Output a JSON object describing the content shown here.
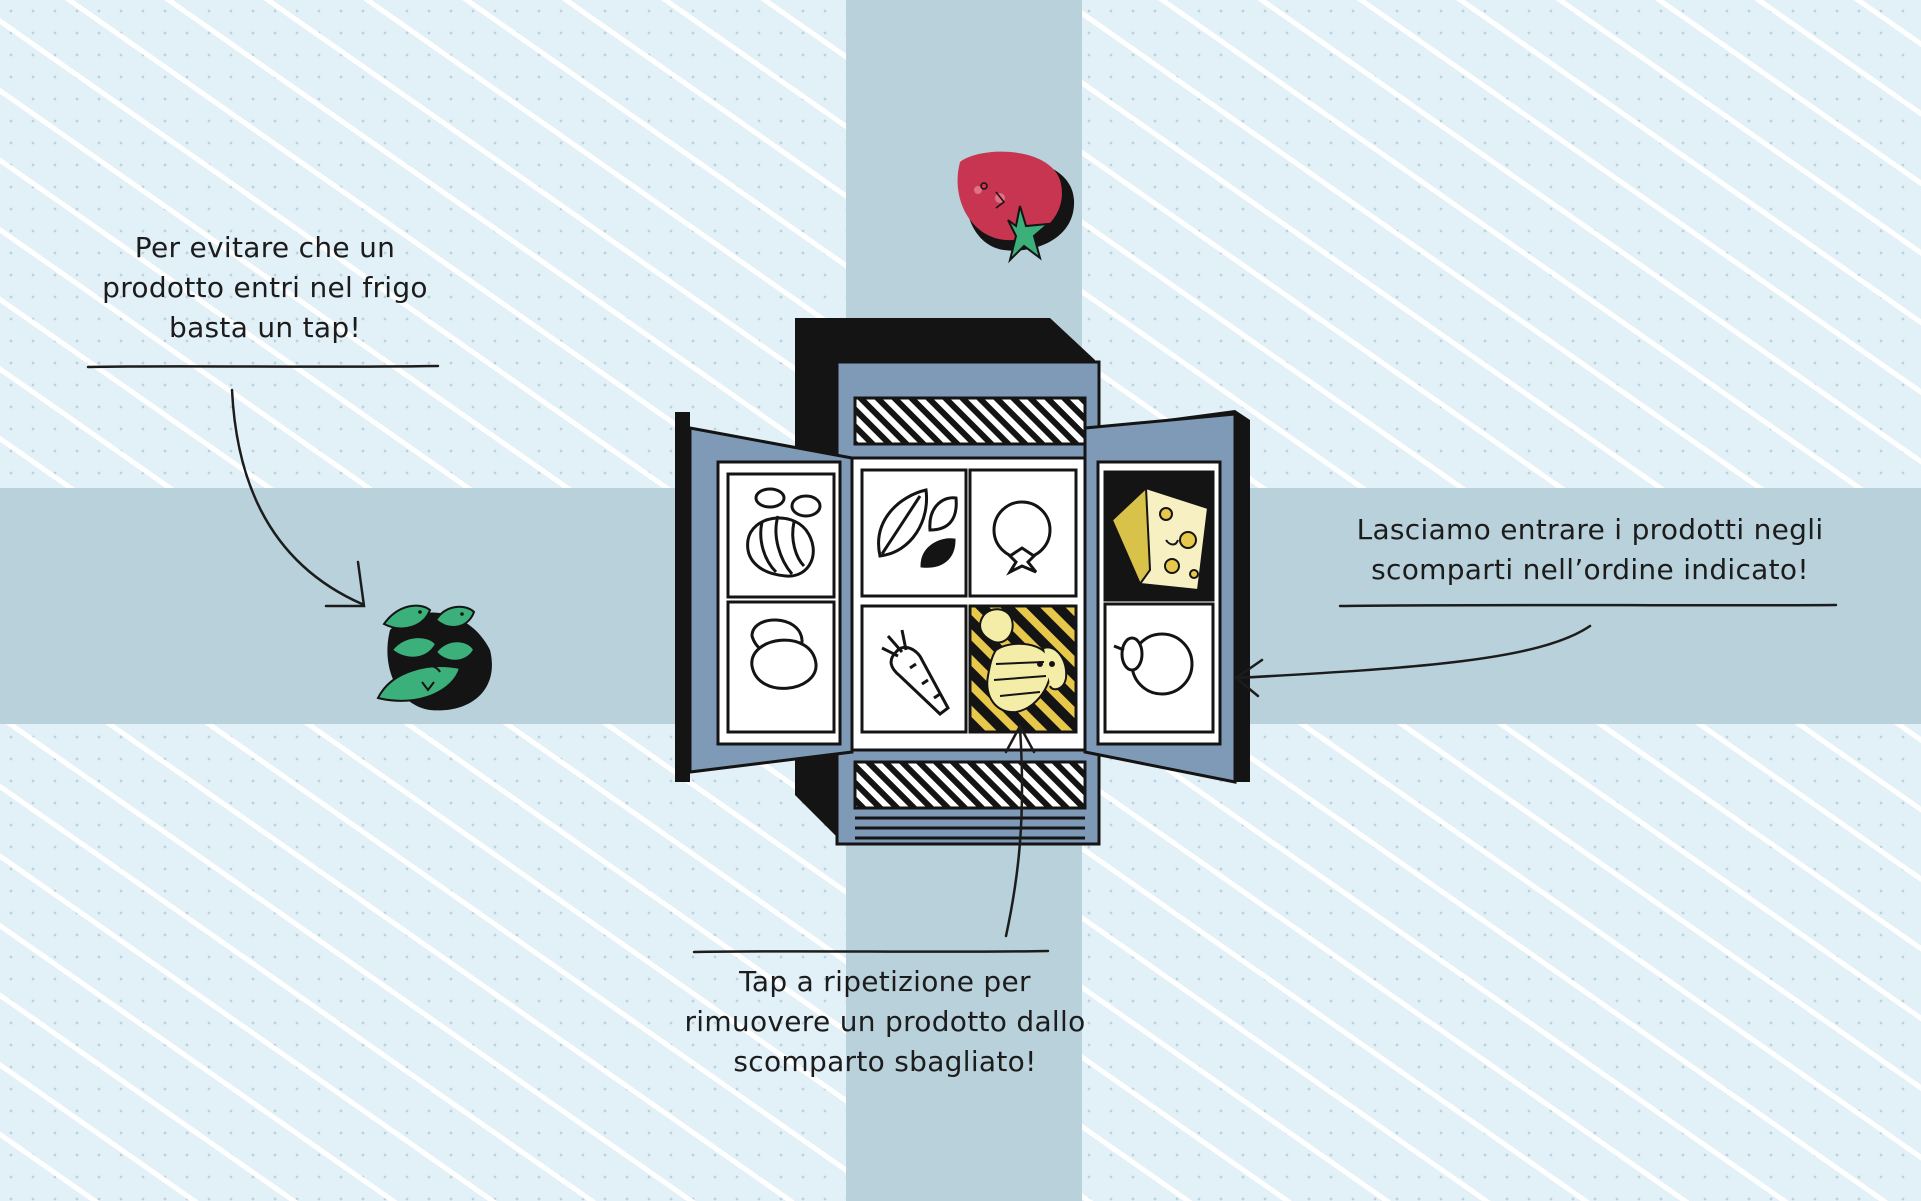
{
  "captions": {
    "tap_to_block": "Per evitare che un\nprodotto entri nel frigo\nbasta un tap!",
    "order": "Lasciamo entrare i prodotti negli\nscomparti nell’ordine indicato!",
    "remove": "Tap a ripetizione per\nrimuovere un prodotto dallo\nscomparto sbagliato!"
  },
  "icons": {
    "falling_tomato": "tomato-icon",
    "falling_basil": "basil-icon",
    "left_door_top": "bread-loaf-icon",
    "left_door_bottom": "mozzarella-icon",
    "center_top_left": "basil-leaf-icon",
    "center_top_right": "tomato-outline-icon",
    "center_bottom_left": "carrot-icon",
    "center_bottom_right": "pasta-icon",
    "right_door_top": "cheese-icon",
    "right_door_bottom": "onion-icon"
  },
  "colors": {
    "background": "#e2f1f8",
    "band": "#b8d1db",
    "fridge_blue": "#7f9ab7",
    "fridge_black": "#141414",
    "tomato_red": "#c73550",
    "basil_green": "#3bb07a",
    "highlight_yellow": "#e8c84a"
  }
}
